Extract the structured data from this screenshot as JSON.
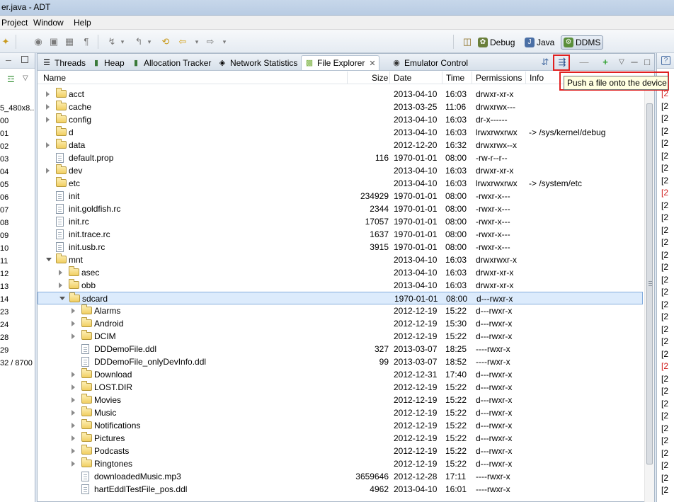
{
  "window": {
    "title": "er.java - ADT"
  },
  "menu": {
    "items": [
      "Project",
      "Window",
      "Help"
    ]
  },
  "perspectives": {
    "debug": "Debug",
    "java": "Java",
    "ddms": "DDMS"
  },
  "left_panel": {
    "rows": [
      "5_480x8...",
      "00",
      "01",
      "02",
      "03",
      "04",
      "05",
      "06",
      "07",
      "08",
      "09",
      "10",
      "11",
      "12",
      "13",
      "14",
      "23",
      "24",
      "28",
      "29",
      "32 / 8700"
    ]
  },
  "tabs": [
    {
      "label": "Threads",
      "icon": "threads-icon"
    },
    {
      "label": "Heap",
      "icon": "heap-icon"
    },
    {
      "label": "Allocation Tracker",
      "icon": "allocation-tracker-icon"
    },
    {
      "label": "Network Statistics",
      "icon": "network-icon"
    },
    {
      "label": "File Explorer",
      "icon": "android-icon",
      "active": true
    },
    {
      "label": "Emulator Control",
      "icon": "emulator-icon"
    }
  ],
  "columns": {
    "name": "Name",
    "size": "Size",
    "date": "Date",
    "time": "Time",
    "permissions": "Permissions",
    "info": "Info"
  },
  "tooltip": "Push a file onto the device",
  "files": [
    {
      "level": 0,
      "kind": "folder",
      "expander": "closed",
      "name": "acct",
      "size": "",
      "date": "2013-04-10",
      "time": "16:03",
      "perm": "drwxr-xr-x",
      "info": ""
    },
    {
      "level": 0,
      "kind": "folder",
      "expander": "closed",
      "name": "cache",
      "size": "",
      "date": "2013-03-25",
      "time": "11:06",
      "perm": "drwxrwx---",
      "info": ""
    },
    {
      "level": 0,
      "kind": "folder",
      "expander": "closed",
      "name": "config",
      "size": "",
      "date": "2013-04-10",
      "time": "16:03",
      "perm": "dr-x------",
      "info": ""
    },
    {
      "level": 0,
      "kind": "folder",
      "expander": "none",
      "name": "d",
      "size": "",
      "date": "2013-04-10",
      "time": "16:03",
      "perm": "lrwxrwxrwx",
      "info": "-> /sys/kernel/debug"
    },
    {
      "level": 0,
      "kind": "folder",
      "expander": "closed",
      "name": "data",
      "size": "",
      "date": "2012-12-20",
      "time": "16:32",
      "perm": "drwxrwx--x",
      "info": ""
    },
    {
      "level": 0,
      "kind": "file",
      "expander": "none",
      "name": "default.prop",
      "size": "116",
      "date": "1970-01-01",
      "time": "08:00",
      "perm": "-rw-r--r--",
      "info": ""
    },
    {
      "level": 0,
      "kind": "folder",
      "expander": "closed",
      "name": "dev",
      "size": "",
      "date": "2013-04-10",
      "time": "16:03",
      "perm": "drwxr-xr-x",
      "info": ""
    },
    {
      "level": 0,
      "kind": "folder",
      "expander": "none",
      "name": "etc",
      "size": "",
      "date": "2013-04-10",
      "time": "16:03",
      "perm": "lrwxrwxrwx",
      "info": "-> /system/etc"
    },
    {
      "level": 0,
      "kind": "file",
      "expander": "none",
      "name": "init",
      "size": "234929",
      "date": "1970-01-01",
      "time": "08:00",
      "perm": "-rwxr-x---",
      "info": ""
    },
    {
      "level": 0,
      "kind": "file",
      "expander": "none",
      "name": "init.goldfish.rc",
      "size": "2344",
      "date": "1970-01-01",
      "time": "08:00",
      "perm": "-rwxr-x---",
      "info": ""
    },
    {
      "level": 0,
      "kind": "file",
      "expander": "none",
      "name": "init.rc",
      "size": "17057",
      "date": "1970-01-01",
      "time": "08:00",
      "perm": "-rwxr-x---",
      "info": ""
    },
    {
      "level": 0,
      "kind": "file",
      "expander": "none",
      "name": "init.trace.rc",
      "size": "1637",
      "date": "1970-01-01",
      "time": "08:00",
      "perm": "-rwxr-x---",
      "info": ""
    },
    {
      "level": 0,
      "kind": "file",
      "expander": "none",
      "name": "init.usb.rc",
      "size": "3915",
      "date": "1970-01-01",
      "time": "08:00",
      "perm": "-rwxr-x---",
      "info": ""
    },
    {
      "level": 0,
      "kind": "folder",
      "expander": "open",
      "name": "mnt",
      "size": "",
      "date": "2013-04-10",
      "time": "16:03",
      "perm": "drwxrwxr-x",
      "info": ""
    },
    {
      "level": 1,
      "kind": "folder",
      "expander": "closed",
      "name": "asec",
      "size": "",
      "date": "2013-04-10",
      "time": "16:03",
      "perm": "drwxr-xr-x",
      "info": ""
    },
    {
      "level": 1,
      "kind": "folder",
      "expander": "closed",
      "name": "obb",
      "size": "",
      "date": "2013-04-10",
      "time": "16:03",
      "perm": "drwxr-xr-x",
      "info": ""
    },
    {
      "level": 1,
      "kind": "folder",
      "expander": "open",
      "name": "sdcard",
      "size": "",
      "date": "1970-01-01",
      "time": "08:00",
      "perm": "d---rwxr-x",
      "info": "",
      "selected": true
    },
    {
      "level": 2,
      "kind": "folder",
      "expander": "closed",
      "name": "Alarms",
      "size": "",
      "date": "2012-12-19",
      "time": "15:22",
      "perm": "d---rwxr-x",
      "info": ""
    },
    {
      "level": 2,
      "kind": "folder",
      "expander": "closed",
      "name": "Android",
      "size": "",
      "date": "2012-12-19",
      "time": "15:30",
      "perm": "d---rwxr-x",
      "info": ""
    },
    {
      "level": 2,
      "kind": "folder",
      "expander": "closed",
      "name": "DCIM",
      "size": "",
      "date": "2012-12-19",
      "time": "15:22",
      "perm": "d---rwxr-x",
      "info": ""
    },
    {
      "level": 2,
      "kind": "file",
      "expander": "none",
      "name": "DDDemoFile.ddl",
      "size": "327",
      "date": "2013-03-07",
      "time": "18:25",
      "perm": "----rwxr-x",
      "info": ""
    },
    {
      "level": 2,
      "kind": "file",
      "expander": "none",
      "name": "DDDemoFile_onlyDevInfo.ddl",
      "size": "99",
      "date": "2013-03-07",
      "time": "18:52",
      "perm": "----rwxr-x",
      "info": ""
    },
    {
      "level": 2,
      "kind": "folder",
      "expander": "closed",
      "name": "Download",
      "size": "",
      "date": "2012-12-31",
      "time": "17:40",
      "perm": "d---rwxr-x",
      "info": ""
    },
    {
      "level": 2,
      "kind": "folder",
      "expander": "closed",
      "name": "LOST.DIR",
      "size": "",
      "date": "2012-12-19",
      "time": "15:22",
      "perm": "d---rwxr-x",
      "info": ""
    },
    {
      "level": 2,
      "kind": "folder",
      "expander": "closed",
      "name": "Movies",
      "size": "",
      "date": "2012-12-19",
      "time": "15:22",
      "perm": "d---rwxr-x",
      "info": ""
    },
    {
      "level": 2,
      "kind": "folder",
      "expander": "closed",
      "name": "Music",
      "size": "",
      "date": "2012-12-19",
      "time": "15:22",
      "perm": "d---rwxr-x",
      "info": ""
    },
    {
      "level": 2,
      "kind": "folder",
      "expander": "closed",
      "name": "Notifications",
      "size": "",
      "date": "2012-12-19",
      "time": "15:22",
      "perm": "d---rwxr-x",
      "info": ""
    },
    {
      "level": 2,
      "kind": "folder",
      "expander": "closed",
      "name": "Pictures",
      "size": "",
      "date": "2012-12-19",
      "time": "15:22",
      "perm": "d---rwxr-x",
      "info": ""
    },
    {
      "level": 2,
      "kind": "folder",
      "expander": "closed",
      "name": "Podcasts",
      "size": "",
      "date": "2012-12-19",
      "time": "15:22",
      "perm": "d---rwxr-x",
      "info": ""
    },
    {
      "level": 2,
      "kind": "folder",
      "expander": "closed",
      "name": "Ringtones",
      "size": "",
      "date": "2012-12-19",
      "time": "15:22",
      "perm": "d---rwxr-x",
      "info": ""
    },
    {
      "level": 2,
      "kind": "file",
      "expander": "none",
      "name": "downloadedMusic.mp3",
      "size": "3659646",
      "date": "2012-12-28",
      "time": "17:11",
      "perm": "----rwxr-x",
      "info": ""
    },
    {
      "level": 2,
      "kind": "file",
      "expander": "none",
      "name": "hartEddlTestFile_pos.ddl",
      "size": "4962",
      "date": "2013-04-10",
      "time": "16:01",
      "perm": "----rwxr-x",
      "info": ""
    }
  ],
  "right_panel": {
    "rows": [
      "[2",
      "[2",
      "[2",
      "[2",
      "[2",
      "[2",
      "[2",
      "[2",
      "[2",
      "[2",
      "[2",
      "[2",
      "[2",
      "[2",
      "[2",
      "[2",
      "[2",
      "[2",
      "[2",
      "[2",
      "[2",
      "[2",
      "[2",
      "[2",
      "[2",
      "[2",
      "[2",
      "[2",
      "[2",
      "[2",
      "[2",
      "[2",
      "[2"
    ],
    "red_rows": [
      0,
      8,
      22
    ]
  },
  "colors": {
    "highlight": "#e02020",
    "selection": "#dcebfc",
    "tooltip_bg": "#ffffe1"
  }
}
